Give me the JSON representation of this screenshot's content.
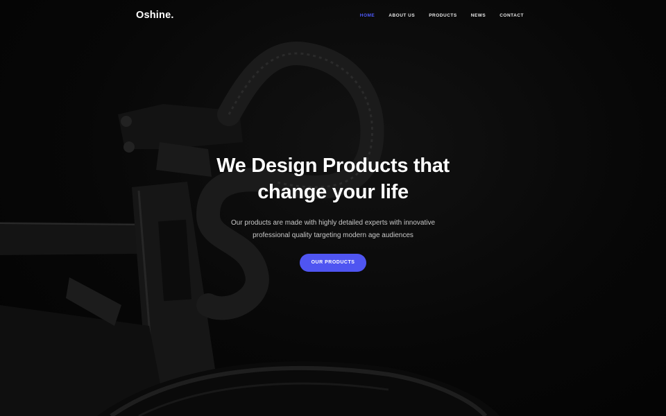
{
  "brand": {
    "logo": "Oshine."
  },
  "nav": {
    "items": [
      {
        "label": "HOME",
        "active": true
      },
      {
        "label": "ABOUT US",
        "active": false
      },
      {
        "label": "PRODUCTS",
        "active": false
      },
      {
        "label": "NEWS",
        "active": false
      },
      {
        "label": "CONTACT",
        "active": false
      }
    ]
  },
  "hero": {
    "headline_line1": "We Design Products that",
    "headline_line2": "change your life",
    "subtext_line1": "Our products are made with highly detailed experts with innovative",
    "subtext_line2": "professional quality targeting modern age audiences",
    "cta_label": "OUR PRODUCTS"
  },
  "colors": {
    "accent": "#4f55f1",
    "active_nav": "#4f5bff",
    "background": "#050505"
  }
}
